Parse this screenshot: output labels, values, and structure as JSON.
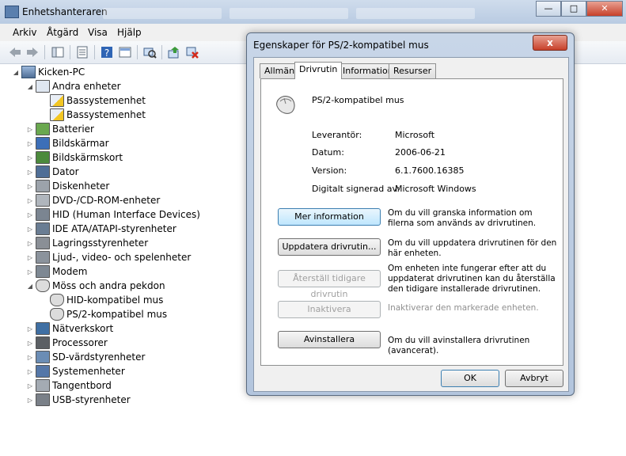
{
  "window": {
    "title": "Enhetshanteraren"
  },
  "menu": [
    "Arkiv",
    "Åtgärd",
    "Visa",
    "Hjälp"
  ],
  "toolbar_icons": [
    "back-arrow-icon",
    "forward-arrow-icon",
    "properties-icon",
    "help-icon",
    "view-icon",
    "scan-hardware-icon",
    "update-driver-icon",
    "uninstall-icon"
  ],
  "tree": {
    "root": "Kicken-PC",
    "nodes": [
      {
        "label": "Andra enheter",
        "icon": "question-device-icon",
        "level": 1,
        "expanded": true
      },
      {
        "label": "Bassystemenhet",
        "icon": "warning-device-icon",
        "level": 2
      },
      {
        "label": "Bassystemenhet",
        "icon": "warning-device-icon",
        "level": 2
      },
      {
        "label": "Batterier",
        "icon": "battery-icon",
        "level": 1
      },
      {
        "label": "Bildskärmar",
        "icon": "monitor-icon",
        "level": 1
      },
      {
        "label": "Bildskärmskort",
        "icon": "display-adapter-icon",
        "level": 1
      },
      {
        "label": "Dator",
        "icon": "computer-icon",
        "level": 1
      },
      {
        "label": "Diskenheter",
        "icon": "disk-drive-icon",
        "level": 1
      },
      {
        "label": "DVD-/CD-ROM-enheter",
        "icon": "dvd-drive-icon",
        "level": 1
      },
      {
        "label": "HID (Human Interface Devices)",
        "icon": "hid-icon",
        "level": 1
      },
      {
        "label": "IDE ATA/ATAPI-styrenheter",
        "icon": "ide-controller-icon",
        "level": 1
      },
      {
        "label": "Lagringsstyrenheter",
        "icon": "storage-controller-icon",
        "level": 1
      },
      {
        "label": "Ljud-, video- och spelenheter",
        "icon": "sound-icon",
        "level": 1
      },
      {
        "label": "Modem",
        "icon": "modem-icon",
        "level": 1
      },
      {
        "label": "Möss och andra pekdon",
        "icon": "mouse-icon",
        "level": 1,
        "expanded": true
      },
      {
        "label": "HID-kompatibel mus",
        "icon": "mouse-icon",
        "level": 2
      },
      {
        "label": "PS/2-kompatibel mus",
        "icon": "mouse-icon",
        "level": 2
      },
      {
        "label": "Nätverkskort",
        "icon": "network-adapter-icon",
        "level": 1
      },
      {
        "label": "Processorer",
        "icon": "processor-icon",
        "level": 1
      },
      {
        "label": "SD-värdstyrenheter",
        "icon": "sd-host-icon",
        "level": 1
      },
      {
        "label": "Systemenheter",
        "icon": "system-device-icon",
        "level": 1
      },
      {
        "label": "Tangentbord",
        "icon": "keyboard-icon",
        "level": 1
      },
      {
        "label": "USB-styrenheter",
        "icon": "usb-icon",
        "level": 1
      }
    ]
  },
  "dialog": {
    "title": "Egenskaper för PS/2-kompatibel mus",
    "close": "x",
    "tabs": [
      "Allmänt",
      "Drivrutin",
      "Information",
      "Resurser"
    ],
    "active_tab": "Drivrutin",
    "device_name": "PS/2-kompatibel mus",
    "fields": [
      {
        "label": "Leverantör:",
        "value": "Microsoft"
      },
      {
        "label": "Datum:",
        "value": "2006-06-21"
      },
      {
        "label": "Version:",
        "value": "6.1.7600.16385"
      },
      {
        "label": "Digitalt signerad av:",
        "value": "Microsoft Windows"
      }
    ],
    "actions": [
      {
        "label": "Mer information",
        "desc": "Om du vill granska information om filerna som används av drivrutinen.",
        "enabled": true
      },
      {
        "label": "Uppdatera drivrutin...",
        "desc": "Om du vill uppdatera drivrutinen för den här enheten.",
        "enabled": true
      },
      {
        "label": "Återställ tidigare drivrutin",
        "desc": "Om enheten inte fungerar efter att du uppdaterat drivrutinen kan du återställa den tidigare installerade drivrutinen.",
        "enabled": false
      },
      {
        "label": "Inaktivera",
        "desc": "Inaktiverar den markerade enheten.",
        "enabled": false
      },
      {
        "label": "Avinstallera",
        "desc": "Om du vill avinstallera drivrutinen (avancerat).",
        "enabled": true
      }
    ],
    "ok": "OK",
    "cancel": "Avbryt"
  }
}
